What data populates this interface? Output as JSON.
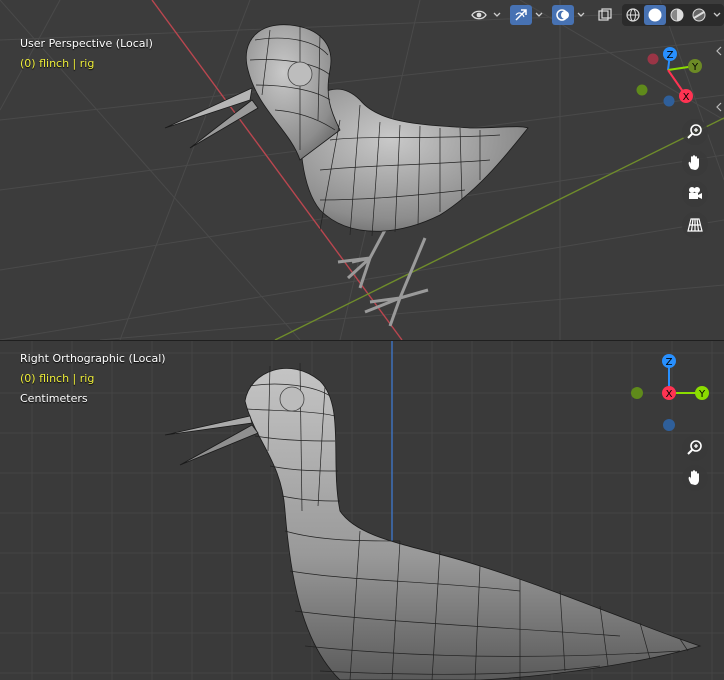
{
  "top_viewport": {
    "view_label": "User Perspective (Local)",
    "object_label": "(0) flinch | rig"
  },
  "bottom_viewport": {
    "view_label": "Right Orthographic (Local)",
    "object_label": "(0) flinch | rig",
    "units_label": "Centimeters"
  },
  "gizmo_top": {
    "axes": [
      "Z",
      "Y",
      "X"
    ]
  },
  "gizmo_bottom": {
    "axes": [
      "Z",
      "X",
      "Y"
    ]
  },
  "header": {
    "icons": [
      "visibility-icon",
      "gizmo-icon",
      "overlay-icon",
      "xray-icon",
      "wireframe-shading-icon",
      "solid-shading-icon",
      "material-shading-icon",
      "rendered-shading-icon"
    ],
    "active_shading": "solid"
  },
  "colors": {
    "axis_x": "#ff3352",
    "axis_y": "#8bdc00",
    "axis_z": "#2890ff",
    "active_button": "#4772b3",
    "object_text": "#ecec3a"
  }
}
